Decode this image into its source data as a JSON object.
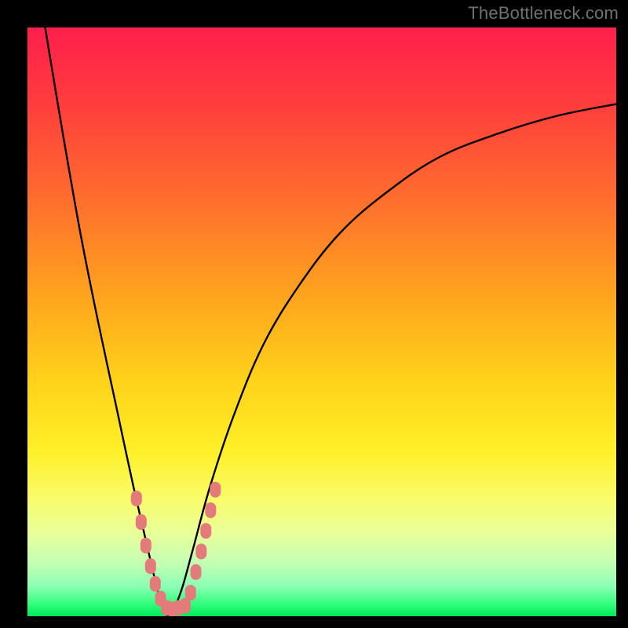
{
  "watermark": "TheBottleneck.com",
  "chart_data": {
    "type": "line",
    "title": "",
    "xlabel": "",
    "ylabel": "",
    "xlim": [
      0,
      100
    ],
    "ylim": [
      0,
      100
    ],
    "background_gradient": {
      "top_color": "#ff1f4c",
      "bottom_color": "#00e85a",
      "meaning": "bottleneck-severity-heat"
    },
    "series": [
      {
        "name": "bottleneck-curve",
        "x": [
          3,
          6,
          9,
          12,
          15,
          18,
          21,
          22.5,
          24,
          26,
          28,
          31,
          35,
          40,
          46,
          53,
          61,
          70,
          80,
          90,
          100
        ],
        "values": [
          100,
          82,
          65,
          50,
          36,
          22,
          9,
          3,
          0,
          4,
          11,
          22,
          34,
          46,
          56,
          65,
          72,
          78,
          82,
          85,
          87
        ]
      }
    ],
    "markers": {
      "name": "highlighted-range-markers",
      "color": "#e37b7b",
      "points_curve_xy": [
        [
          18.5,
          20
        ],
        [
          19.3,
          16
        ],
        [
          20.1,
          12
        ],
        [
          20.9,
          8.5
        ],
        [
          21.7,
          5.5
        ],
        [
          22.6,
          3
        ],
        [
          23.6,
          1.4
        ],
        [
          24.6,
          1.2
        ],
        [
          25.6,
          1.4
        ],
        [
          26.8,
          1.8
        ],
        [
          27.7,
          4
        ],
        [
          28.6,
          7.5
        ],
        [
          29.5,
          11
        ],
        [
          30.3,
          14.5
        ],
        [
          31.1,
          18
        ],
        [
          31.9,
          21.5
        ]
      ]
    }
  }
}
